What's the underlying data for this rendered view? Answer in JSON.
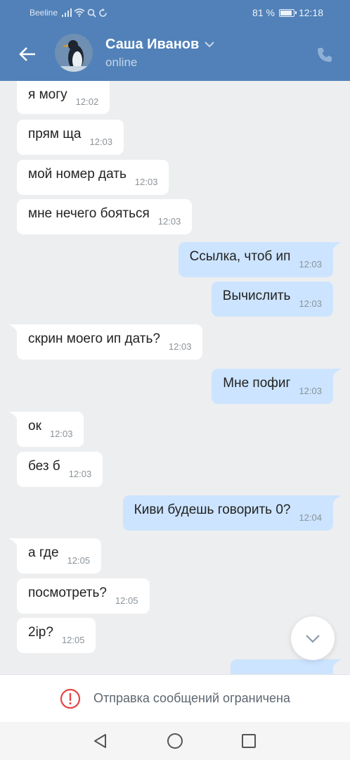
{
  "status_bar": {
    "carrier": "Beeline",
    "battery": "81 %",
    "battery_level": 0.81,
    "time": "12:18",
    "icons": [
      "signal-icon",
      "wifi-icon",
      "search-icon",
      "sync-icon"
    ]
  },
  "header": {
    "contact_name": "Саша Иванов",
    "status": "online",
    "icons": [
      "back-arrow-icon",
      "chevron-down-icon",
      "phone-icon"
    ]
  },
  "messages": [
    {
      "dir": "in",
      "text": "я могу",
      "time": "12:02"
    },
    {
      "dir": "in",
      "text": "прям ща",
      "time": "12:03"
    },
    {
      "dir": "in",
      "text": "мой номер дать",
      "time": "12:03"
    },
    {
      "dir": "in",
      "text": "мне нечего бояться",
      "time": "12:03"
    },
    {
      "dir": "out",
      "text": "Ссылка, чтоб ип",
      "time": "12:03"
    },
    {
      "dir": "out",
      "text": "Вычислить",
      "time": "12:03"
    },
    {
      "dir": "in",
      "text": "скрин моего ип дать?",
      "time": "12:03"
    },
    {
      "dir": "out",
      "text": "Мне пофиг",
      "time": "12:03"
    },
    {
      "dir": "in",
      "text": "ок",
      "time": "12:03"
    },
    {
      "dir": "in",
      "text": "без б",
      "time": "12:03"
    },
    {
      "dir": "out",
      "text": "Киви будешь говорить 0?",
      "time": "12:04"
    },
    {
      "dir": "in",
      "text": "а где",
      "time": "12:05"
    },
    {
      "dir": "in",
      "text": "посмотреть?",
      "time": "12:05"
    },
    {
      "dir": "in",
      "text": "2ip?",
      "time": "12:05"
    },
    {
      "dir": "out",
      "text": "",
      "time": ""
    }
  ],
  "restricted": {
    "label": "Отправка сообщений ограничена",
    "icon": "alert-circle-icon",
    "color": "#e64646"
  },
  "colors": {
    "header": "#5181b8",
    "incoming_bubble": "#ffffff",
    "outgoing_bubble": "#cce4ff",
    "background": "#edeef0"
  },
  "navbar": {
    "icons": [
      "back-triangle-icon",
      "home-circle-icon",
      "recents-square-icon"
    ]
  }
}
